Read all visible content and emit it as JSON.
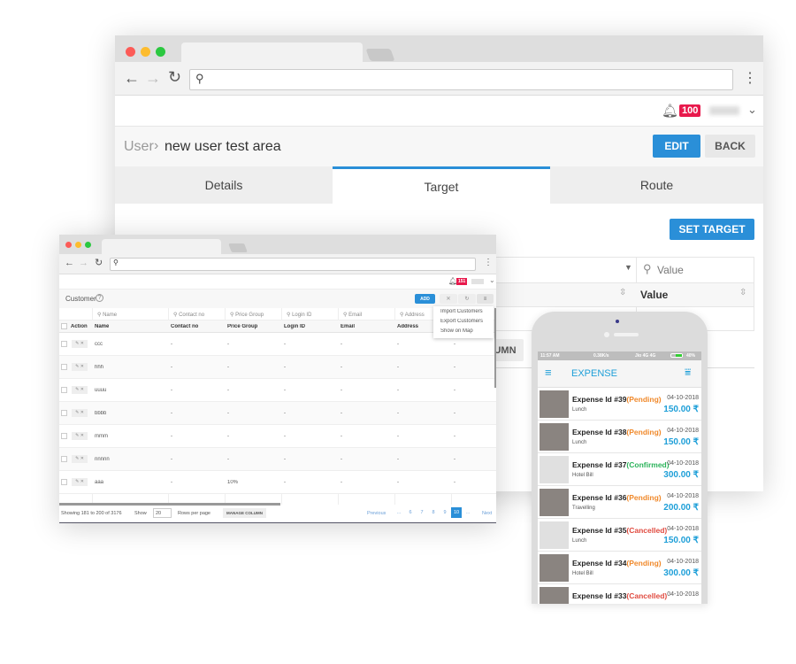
{
  "main_window": {
    "notification_count": "100",
    "breadcrumb": {
      "parent": "User",
      "separator": "›",
      "current": "new user test area"
    },
    "edit_label": "EDIT",
    "back_label": "BACK",
    "tabs": [
      {
        "label": "Details"
      },
      {
        "label": "Target",
        "active": true
      },
      {
        "label": "Route"
      }
    ],
    "set_target_label": "SET TARGET",
    "filter_value_placeholder": "Value",
    "column_value": "Value",
    "manage_column_partial": "UMN"
  },
  "customer_window": {
    "notification_count": "151",
    "title": "Customer",
    "add_label": "ADD",
    "menu": [
      "Import Customers",
      "Export Customers",
      "Show on Map"
    ],
    "filters": [
      "Name",
      "Contact no",
      "Price Group",
      "Login ID",
      "Email",
      "Address"
    ],
    "columns": [
      "Action",
      "Name",
      "Contact no",
      "Price Group",
      "Login ID",
      "Email",
      "Address"
    ],
    "rows": [
      {
        "name": "ccc",
        "contact": "-",
        "price": "-",
        "login": "-",
        "email": "-",
        "address": "-",
        "extra": "-"
      },
      {
        "name": "hhh",
        "contact": "-",
        "price": "-",
        "login": "-",
        "email": "-",
        "address": "-",
        "extra": "-"
      },
      {
        "name": "uuuu",
        "contact": "-",
        "price": "-",
        "login": "-",
        "email": "-",
        "address": "-",
        "extra": "-"
      },
      {
        "name": "bbbb",
        "contact": "-",
        "price": "-",
        "login": "-",
        "email": "-",
        "address": "-",
        "extra": "-"
      },
      {
        "name": "mmm",
        "contact": "-",
        "price": "-",
        "login": "-",
        "email": "-",
        "address": "-",
        "extra": "-"
      },
      {
        "name": "nnnnn",
        "contact": "-",
        "price": "-",
        "login": "-",
        "email": "-",
        "address": "-",
        "extra": "-"
      },
      {
        "name": "aaa",
        "contact": "-",
        "price": "10%",
        "login": "-",
        "email": "-",
        "address": "-",
        "extra": "-"
      }
    ],
    "footer": {
      "showing": "Showing 181 to 200 of 3176",
      "show_label": "Show",
      "rows_value": "20",
      "rows_per_page": "Rows per page",
      "manage_column": "MANAGE COLUMN",
      "previous": "Previous",
      "pages": [
        "...",
        "6",
        "7",
        "8",
        "9",
        "10",
        "..."
      ],
      "active_page": "10",
      "next": "Next"
    }
  },
  "phone": {
    "status": {
      "time": "11:57 AM",
      "speed": "0.38K/s",
      "carrier": "Jio 4G 4G",
      "battery": "40%"
    },
    "title": "EXPENSE",
    "expenses": [
      {
        "id": "Expense Id #39",
        "status": "(Pending)",
        "category": "Lunch",
        "date": "04-10-2018",
        "amount": "150.00 ₹",
        "photo": true
      },
      {
        "id": "Expense Id #38",
        "status": "(Pending)",
        "category": "Lunch",
        "date": "04-10-2018",
        "amount": "150.00 ₹",
        "photo": true
      },
      {
        "id": "Expense Id #37",
        "status": "(Confirmed)",
        "category": "Hotel Bill",
        "date": "04-10-2018",
        "amount": "300.00 ₹",
        "photo": false
      },
      {
        "id": "Expense Id #36",
        "status": "(Pending)",
        "category": "Travelling",
        "date": "04-10-2018",
        "amount": "200.00 ₹",
        "photo": true
      },
      {
        "id": "Expense Id #35",
        "status": "(Cancelled)",
        "category": "Lunch",
        "date": "04-10-2018",
        "amount": "150.00 ₹",
        "photo": false
      },
      {
        "id": "Expense Id #34",
        "status": "(Pending)",
        "category": "Hotel Bill",
        "date": "04-10-2018",
        "amount": "300.00 ₹",
        "photo": true
      },
      {
        "id": "Expense Id #33",
        "status": "(Cancelled)",
        "category": "",
        "date": "04-10-2018",
        "amount": "",
        "photo": true
      }
    ]
  },
  "colors": {
    "primary": "#2a8fd8",
    "badge": "#e8194c",
    "pending": "#f0892b",
    "confirmed": "#2bb35a",
    "cancelled": "#e04a3f",
    "phone_accent": "#1e9fd8"
  }
}
